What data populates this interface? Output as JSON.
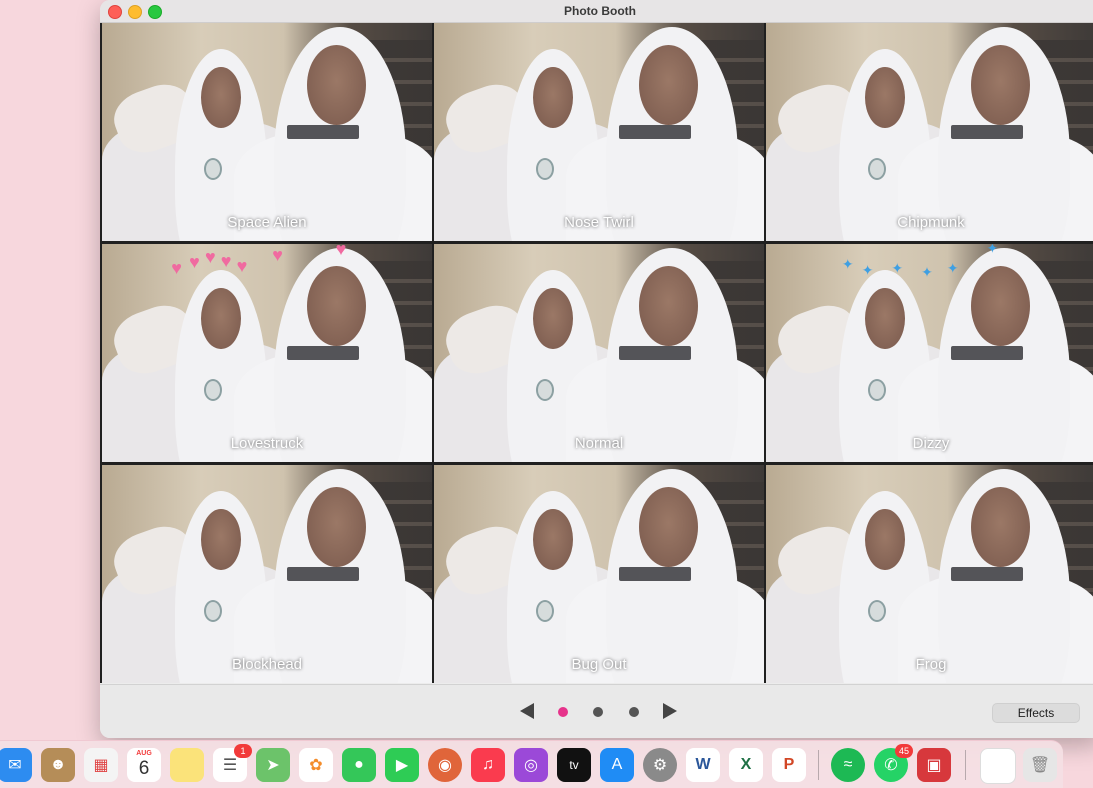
{
  "window": {
    "title": "Photo Booth"
  },
  "effects_grid": [
    {
      "label": "Space Alien",
      "overlay": ""
    },
    {
      "label": "Nose Twirl",
      "overlay": ""
    },
    {
      "label": "Chipmunk",
      "overlay": ""
    },
    {
      "label": "Lovestruck",
      "overlay": "hearts"
    },
    {
      "label": "Normal",
      "overlay": ""
    },
    {
      "label": "Dizzy",
      "overlay": "birds"
    },
    {
      "label": "Blockhead",
      "overlay": ""
    },
    {
      "label": "Bug Out",
      "overlay": ""
    },
    {
      "label": "Frog",
      "overlay": ""
    }
  ],
  "pagination": {
    "pages": 3,
    "current": 1
  },
  "bottombar": {
    "effects_label": "Effects"
  },
  "dock": {
    "calendar_month": "AUG",
    "calendar_day": "6",
    "reminders_badge": "1",
    "whatsapp_badge": "45",
    "apps": [
      {
        "name": "mail-icon",
        "color": "#2d8cf0"
      },
      {
        "name": "contacts-icon",
        "color": "#b58d58"
      },
      {
        "name": "launchpad-icon",
        "color": "#f4f4f4"
      },
      {
        "name": "calendar-icon",
        "color": "#ffffff"
      },
      {
        "name": "notes-icon",
        "color": "#fbe37a"
      },
      {
        "name": "reminders-icon",
        "color": "#ffffff"
      },
      {
        "name": "maps-icon",
        "color": "#6cc36a"
      },
      {
        "name": "photos-icon",
        "color": "#ffffff"
      },
      {
        "name": "messages-icon",
        "color": "#34c759"
      },
      {
        "name": "facetime-icon",
        "color": "#2ecc55"
      },
      {
        "name": "photo-booth-dock-icon",
        "color": "#e0653a"
      },
      {
        "name": "music-icon",
        "color": "#fa3b4e"
      },
      {
        "name": "podcasts-icon",
        "color": "#9b49d8"
      },
      {
        "name": "tv-icon",
        "color": "#111111"
      },
      {
        "name": "app-store-icon",
        "color": "#1f8cf5"
      },
      {
        "name": "system-preferences-icon",
        "color": "#8a8a8a"
      },
      {
        "name": "word-icon",
        "color": "#ffffff"
      },
      {
        "name": "excel-icon",
        "color": "#ffffff"
      },
      {
        "name": "powerpoint-icon",
        "color": "#ffffff"
      },
      {
        "name": "spotify-icon",
        "color": "#1db954"
      },
      {
        "name": "whatsapp-icon",
        "color": "#25d366"
      },
      {
        "name": "preview-icon",
        "color": "#d7383c"
      },
      {
        "name": "document-icon",
        "color": "#ffffff"
      },
      {
        "name": "trash-icon",
        "color": "#e6e6e6"
      }
    ],
    "icon_text": {
      "tv": "tv",
      "word": "W",
      "excel": "X",
      "powerpoint": "P"
    }
  }
}
